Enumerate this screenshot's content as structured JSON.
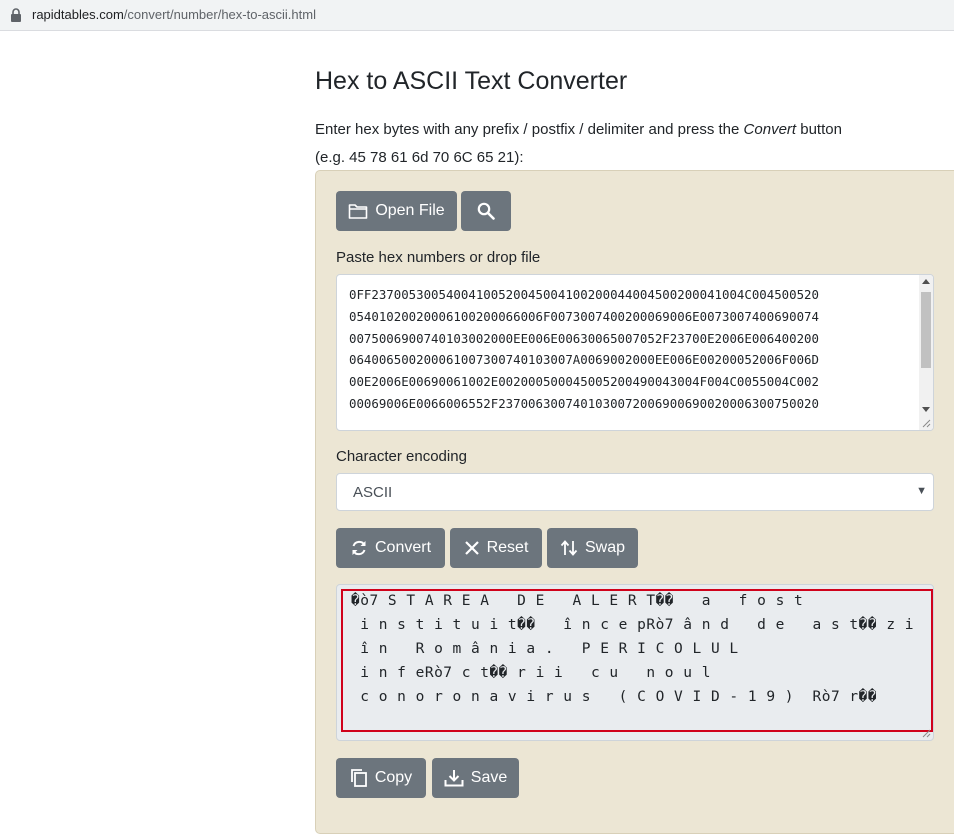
{
  "browser": {
    "url_host": "rapidtables.com",
    "url_path": "/convert/number/hex-to-ascii.html"
  },
  "page": {
    "title": "Hex to ASCII Text Converter",
    "intro_before": "Enter hex bytes with any prefix / postfix / delimiter and press the ",
    "intro_em": "Convert",
    "intro_after": " button",
    "example": "(e.g. 45 78 61 6d 70 6C 65 21):"
  },
  "toolbar": {
    "open_file_label": "Open File"
  },
  "input": {
    "label": "Paste hex numbers or drop file",
    "lines": [
      "0FF2370053005400410052004500410020004400450020004100 4C004500520",
      "054010200200061002000660 06F007300740020006 9006E0073007400690074",
      "0075006900740103002000EE006E00630065007052F23700E2006E006400200",
      "064006500200061007300740103007A0069002000EE006E00200052006F006D",
      "00E2006E00690061002E0020005000450052004900430 04F004C0055004C002",
      "00069006E0066006552F23700630074010300720069006900200063007500 20"
    ]
  },
  "encoding": {
    "label": "Character encoding",
    "selected": "ASCII"
  },
  "actions": {
    "convert_label": "Convert",
    "reset_label": "Reset",
    "swap_label": "Swap"
  },
  "output": {
    "lines": [
      "�ò7 S T A R E A   D E   A L E R T��   a   f o s t",
      " i n s t i t u i t��   î n c e pRò7 â n d   d e   a s t�� z i",
      " î n   R o m â n i a .   P E R I C O L U L",
      " i n f eRò7 c t�� r i i   c u   n o u l",
      " c o n o r o n a v i r u s   ( C O V I D - 1 9 )  Rò7 r��"
    ]
  },
  "footer_actions": {
    "copy_label": "Copy",
    "save_label": "Save"
  },
  "colors": {
    "panel_bg": "#ece6d4",
    "button_bg": "#6c757d",
    "highlight_border": "#d0021b"
  }
}
